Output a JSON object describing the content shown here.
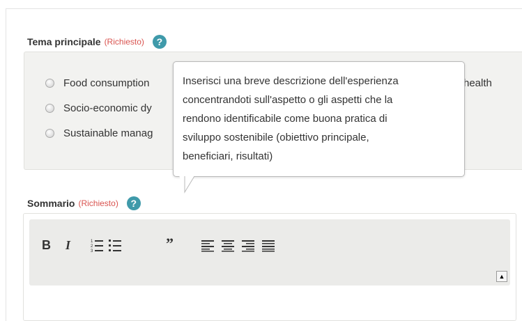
{
  "tema": {
    "label": "Tema principale",
    "required": "(Richiesto)",
    "help": "?",
    "options": [
      "Food consumption",
      "Socio-economic dy",
      "Sustainable manag"
    ],
    "partial_text": "health"
  },
  "tooltip": {
    "text": "Inserisci una breve descrizione dell'esperienza concentrandoti sull'aspetto o gli aspetti che la rendono identificabile come buona pratica di sviluppo sostenibile (obiettivo principale, beneficiari, risultati)",
    "lines": [
      "Inserisci una breve descrizione dell'esperienza",
      "concentrandoti sull'aspetto o gli aspetti che la",
      "rendono identificabile come buona pratica di",
      "sviluppo sostenibile (obiettivo principale,",
      "beneficiari, risultati)"
    ]
  },
  "sommario": {
    "label": "Sommario",
    "required": "(Richiesto)",
    "help": "?"
  },
  "editor": {
    "toolbar": {
      "bold": "B",
      "italic": "I",
      "quote": "”",
      "icons": [
        "bold-icon",
        "italic-icon",
        "ordered-list-icon",
        "unordered-list-icon",
        "blockquote-icon",
        "align-left-icon",
        "align-center-icon",
        "align-right-icon",
        "align-justify-icon"
      ]
    },
    "scroll_symbol": "▲"
  },
  "colors": {
    "required": "#d9534f",
    "help_icon": "#3f9aaa",
    "panel_bg": "#f2f2f0",
    "toolbar_bg": "#ebebe9"
  }
}
